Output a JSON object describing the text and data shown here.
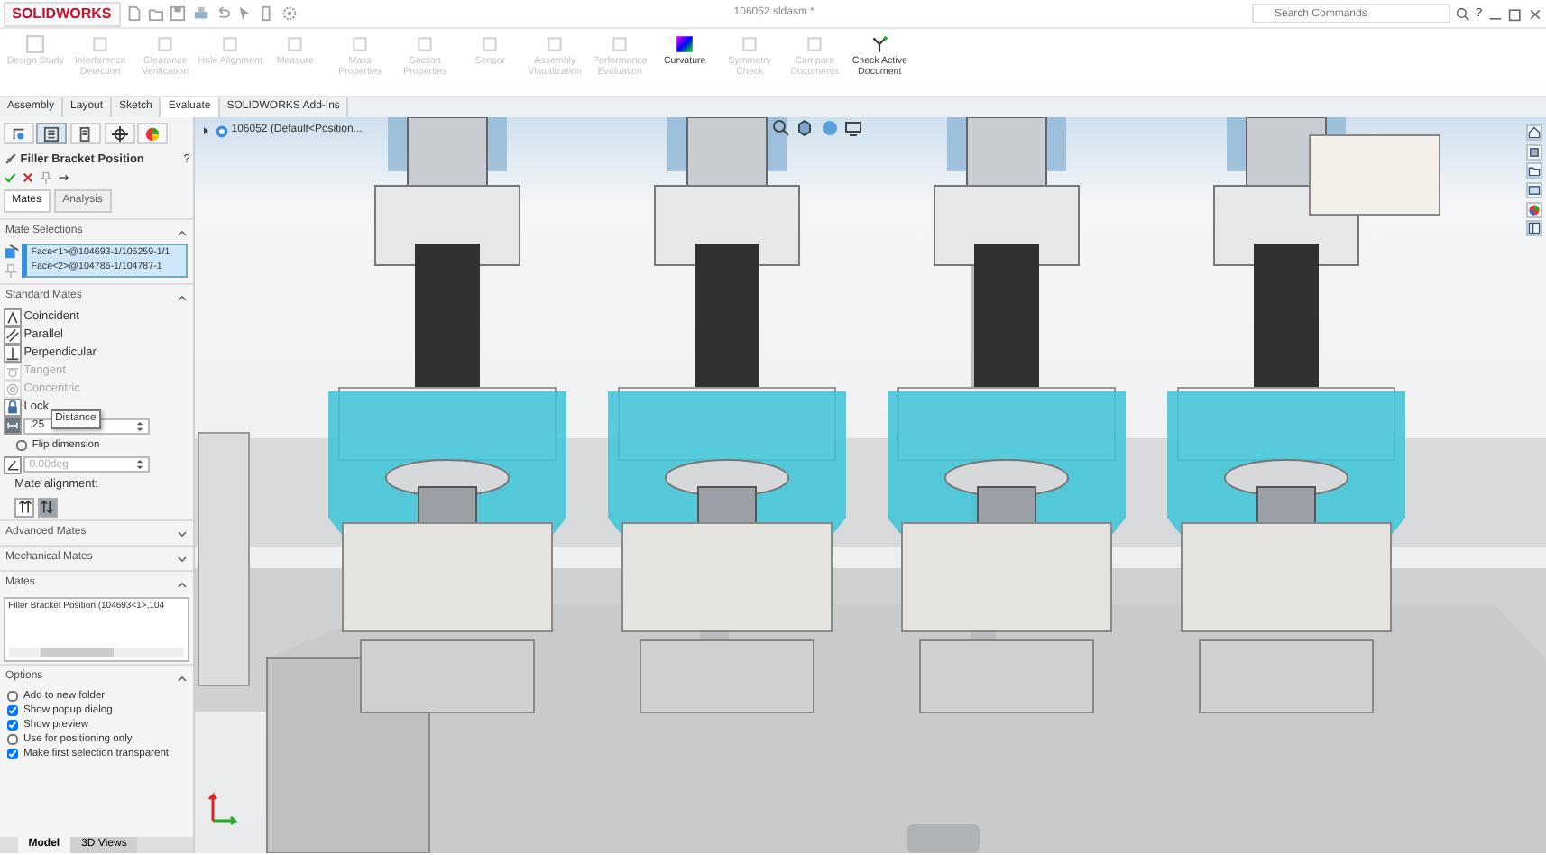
{
  "window": {
    "app_name": "SOLIDWORKS",
    "title": "106052.sldasm *",
    "search": {
      "placeholder": "Search Commands"
    },
    "help_glyph": "?"
  },
  "ribbon": [
    {
      "label": "Design Study",
      "disabled": true,
      "kind": "study"
    },
    {
      "label": "Interference Detection",
      "disabled": true,
      "kind": "generic"
    },
    {
      "label": "Clearance Verification",
      "disabled": true,
      "kind": "generic"
    },
    {
      "label": "Hole Alignment",
      "disabled": true,
      "kind": "generic"
    },
    {
      "label": "Measure",
      "disabled": true,
      "kind": "generic"
    },
    {
      "label": "Mass Properties",
      "disabled": true,
      "kind": "generic"
    },
    {
      "label": "Section Properties",
      "disabled": true,
      "kind": "generic"
    },
    {
      "label": "Sensor",
      "disabled": true,
      "kind": "generic"
    },
    {
      "label": "Assembly Visualization",
      "disabled": true,
      "kind": "generic"
    },
    {
      "label": "Performance Evaluation",
      "disabled": true,
      "kind": "generic"
    },
    {
      "label": "Curvature",
      "disabled": false,
      "kind": "curvature"
    },
    {
      "label": "Symmetry Check",
      "disabled": true,
      "kind": "generic"
    },
    {
      "label": "Compare Documents",
      "disabled": true,
      "kind": "generic"
    },
    {
      "label": "Check Active Document",
      "disabled": false,
      "kind": "check"
    }
  ],
  "command_tabs": [
    {
      "label": "Assembly",
      "selected": false
    },
    {
      "label": "Layout",
      "selected": false
    },
    {
      "label": "Sketch",
      "selected": false
    },
    {
      "label": "Evaluate",
      "selected": true
    },
    {
      "label": "SOLIDWORKS Add-Ins",
      "selected": false
    }
  ],
  "property_manager": {
    "panel_tabs": [
      {
        "selected": false
      },
      {
        "selected": true
      },
      {
        "selected": false
      },
      {
        "selected": false
      },
      {
        "selected": false
      }
    ],
    "title": "Filler Bracket Position",
    "help_glyph": "?",
    "tabs": [
      {
        "label": "Mates",
        "selected": true
      },
      {
        "label": "Analysis",
        "selected": false
      }
    ],
    "mate_selections": {
      "title": "Mate Selections",
      "expanded": true,
      "entries": [
        "Face<1>@104693-1/105259-1/1",
        "Face<2>@104786-1/104787-1"
      ]
    },
    "standard_mates": {
      "title": "Standard Mates",
      "expanded": true,
      "items": [
        {
          "label": "Coincident",
          "kind": "coincident",
          "disabled": false
        },
        {
          "label": "Parallel",
          "kind": "parallel",
          "disabled": false
        },
        {
          "label": "Perpendicular",
          "kind": "perpendicular",
          "disabled": false
        },
        {
          "label": "Tangent",
          "kind": "tangent",
          "disabled": true
        },
        {
          "label": "Concentric",
          "kind": "concentric",
          "disabled": true
        },
        {
          "label": "Lock",
          "kind": "lock",
          "disabled": false
        }
      ],
      "tooltip": "Distance",
      "distance": {
        "value": ".25",
        "selected": true
      },
      "flip_dimension": {
        "label": "Flip dimension",
        "checked": false
      },
      "angle": {
        "value": "0.00deg",
        "disabled": true
      },
      "alignment_label": "Mate alignment:",
      "alignment": [
        {
          "selected": false
        },
        {
          "selected": true
        }
      ]
    },
    "advanced_mates": {
      "title": "Advanced Mates",
      "expanded": false
    },
    "mechanical_mates": {
      "title": "Mechanical Mates",
      "expanded": false
    },
    "mates": {
      "title": "Mates",
      "expanded": true,
      "entries": [
        "Filler Bracket Position (104693<1>,104"
      ]
    },
    "options": {
      "title": "Options",
      "expanded": true,
      "items": [
        {
          "label": "Add to new folder",
          "checked": false
        },
        {
          "label": "Show popup dialog",
          "checked": true
        },
        {
          "label": "Show preview",
          "checked": true
        },
        {
          "label": "Use for positioning only",
          "checked": false
        },
        {
          "label": "Make first selection transparent",
          "checked": true
        }
      ]
    }
  },
  "viewport": {
    "tree_flyout": "106052  (Default<Position..."
  },
  "bottom_tabs": [
    {
      "label": "Model",
      "selected": true
    },
    {
      "label": "3D Views",
      "selected": false
    }
  ]
}
